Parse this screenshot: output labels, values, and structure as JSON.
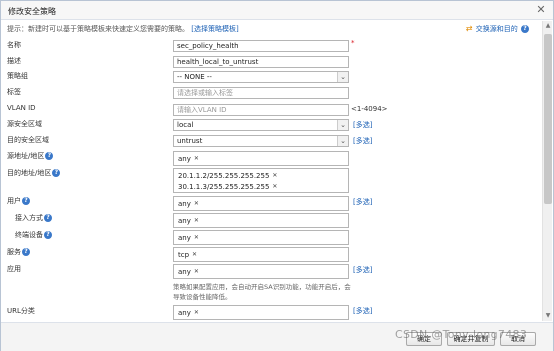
{
  "dialog": {
    "title": "修改安全策略",
    "close_glyph": "✕"
  },
  "hint": {
    "text": "提示：新建时可以基于策略模板来快速定义您需要的策略。",
    "link": "[选择策略模板]"
  },
  "swap": {
    "label": "交换源和目的"
  },
  "help_glyph": "?",
  "form": {
    "name": {
      "label": "名称",
      "value": "sec_policy_health",
      "required_mark": "*"
    },
    "description": {
      "label": "描述",
      "value": "health_local_to_untrust"
    },
    "policy_group": {
      "label": "策略组",
      "value": "-- NONE --"
    },
    "tag": {
      "label": "标签",
      "placeholder": "请选择或输入标签"
    },
    "vlan": {
      "label": "VLAN ID",
      "placeholder": "请输入VLAN ID",
      "range": "<1-4094>"
    },
    "src_zone": {
      "label": "源安全区域",
      "value": "local",
      "more": "[多选]"
    },
    "dst_zone": {
      "label": "目的安全区域",
      "value": "untrust",
      "more": "[多选]"
    },
    "src_addr": {
      "label": "源地址/地区",
      "tags": [
        "any"
      ]
    },
    "dst_addr": {
      "label": "目的地址/地区",
      "tags": [
        "20.1.1.2/255.255.255.255",
        "30.1.1.3/255.255.255.255"
      ]
    },
    "user": {
      "label": "用户",
      "tags": [
        "any"
      ],
      "more": "[多选]"
    },
    "access_mode": {
      "label": "接入方式",
      "tags": [
        "any"
      ]
    },
    "terminal": {
      "label": "终端设备",
      "tags": [
        "any"
      ]
    },
    "service": {
      "label": "服务",
      "tags": [
        "tcp"
      ]
    },
    "application": {
      "label": "应用",
      "tags": [
        "any"
      ],
      "more": "[多选]",
      "note": "策略如果配置应用，会自动开启SA识别功能，功能开启后，会导致设备性能降低。"
    },
    "url": {
      "label": "URL分类",
      "tags": [
        "any"
      ],
      "more": "[多选]"
    }
  },
  "footer": {
    "ok": "确定",
    "copy": "确定并复制",
    "cancel": "取消"
  },
  "watermark": "CSDN @Tony-long7483"
}
